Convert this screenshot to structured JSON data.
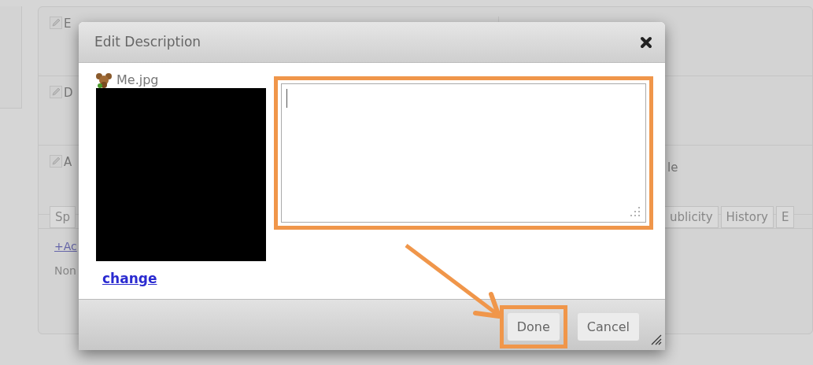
{
  "background": {
    "rows": [
      {
        "label": "E"
      },
      {
        "label": "D"
      },
      {
        "label": "A",
        "right_label": "le"
      }
    ],
    "left_tabs": [
      {
        "label": "Sp"
      }
    ],
    "right_tabs": [
      {
        "label": "ublicity"
      },
      {
        "label": "History"
      },
      {
        "label": "E"
      }
    ],
    "add_link": "+Ac",
    "empty_text": "Non"
  },
  "dialog": {
    "title": "Edit Description",
    "file_name": "Me.jpg",
    "change_link": "change",
    "description": {
      "highlighted": true
    },
    "buttons": [
      {
        "label": "Done",
        "highlighted": true
      },
      {
        "label": "Cancel",
        "highlighted": false
      }
    ]
  }
}
